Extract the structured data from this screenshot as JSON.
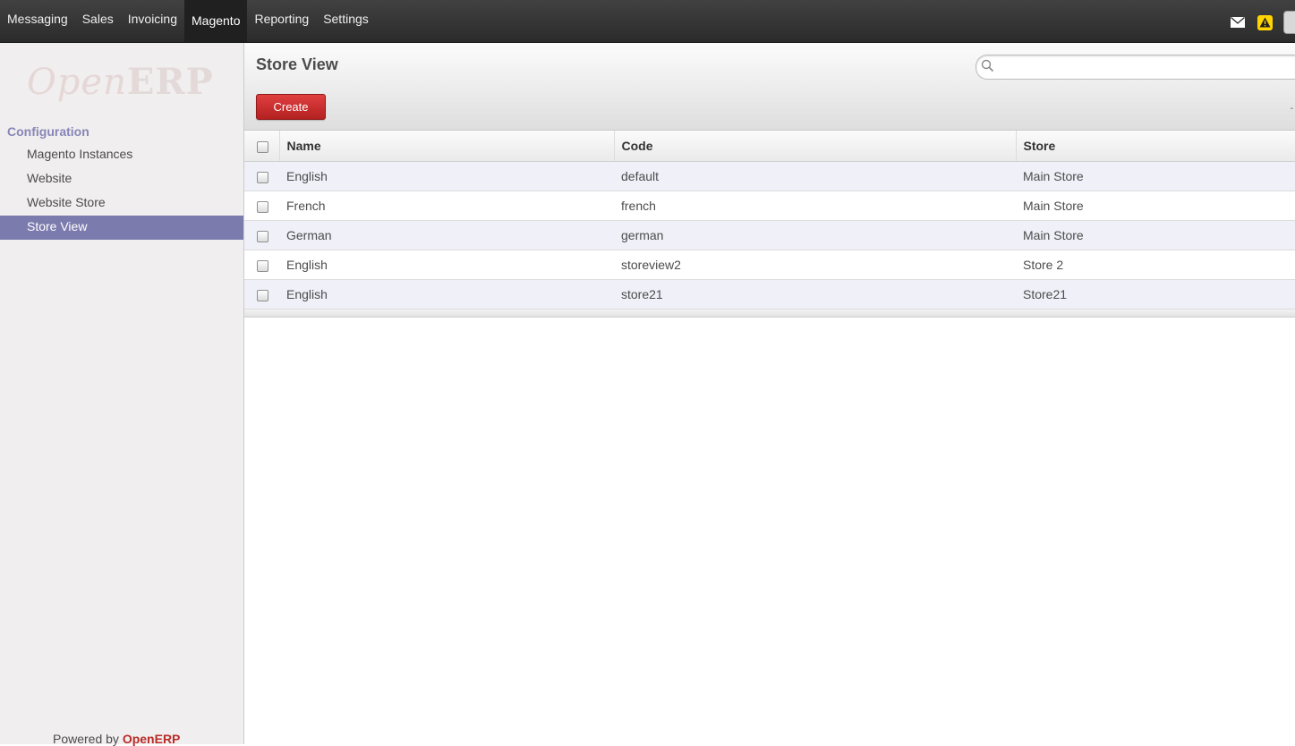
{
  "topbar": {
    "menu": [
      {
        "label": "Messaging",
        "active": false
      },
      {
        "label": "Sales",
        "active": false
      },
      {
        "label": "Invoicing",
        "active": false
      },
      {
        "label": "Magento",
        "active": true
      },
      {
        "label": "Reporting",
        "active": false
      },
      {
        "label": "Settings",
        "active": false
      }
    ],
    "icons": [
      "mail-icon",
      "alert-icon",
      "avatar"
    ]
  },
  "sidebar": {
    "logo": {
      "open": "Open",
      "erp": "ERP"
    },
    "section_title": "Configuration",
    "items": [
      {
        "label": "Magento Instances",
        "active": false
      },
      {
        "label": "Website",
        "active": false
      },
      {
        "label": "Website Store",
        "active": false
      },
      {
        "label": "Store View",
        "active": true
      }
    ],
    "powered_by": "Powered by",
    "powered_brand": "OpenERP"
  },
  "header": {
    "title": "Store View",
    "create_label": "Create",
    "search_placeholder": "",
    "dash": "-"
  },
  "table": {
    "columns": [
      "Name",
      "Code",
      "Store"
    ],
    "rows": [
      {
        "name": "English",
        "code": "default",
        "store": "Main Store"
      },
      {
        "name": "French",
        "code": "french",
        "store": "Main Store"
      },
      {
        "name": "German",
        "code": "german",
        "store": "Main Store"
      },
      {
        "name": "English",
        "code": "storeview2",
        "store": "Store 2"
      },
      {
        "name": "English",
        "code": "store21",
        "store": "Store21"
      }
    ]
  },
  "colors": {
    "accent": "#7c7bad",
    "create_button": "#c52b2b",
    "topbar": "#333333",
    "row_alt": "#eff0f8"
  }
}
